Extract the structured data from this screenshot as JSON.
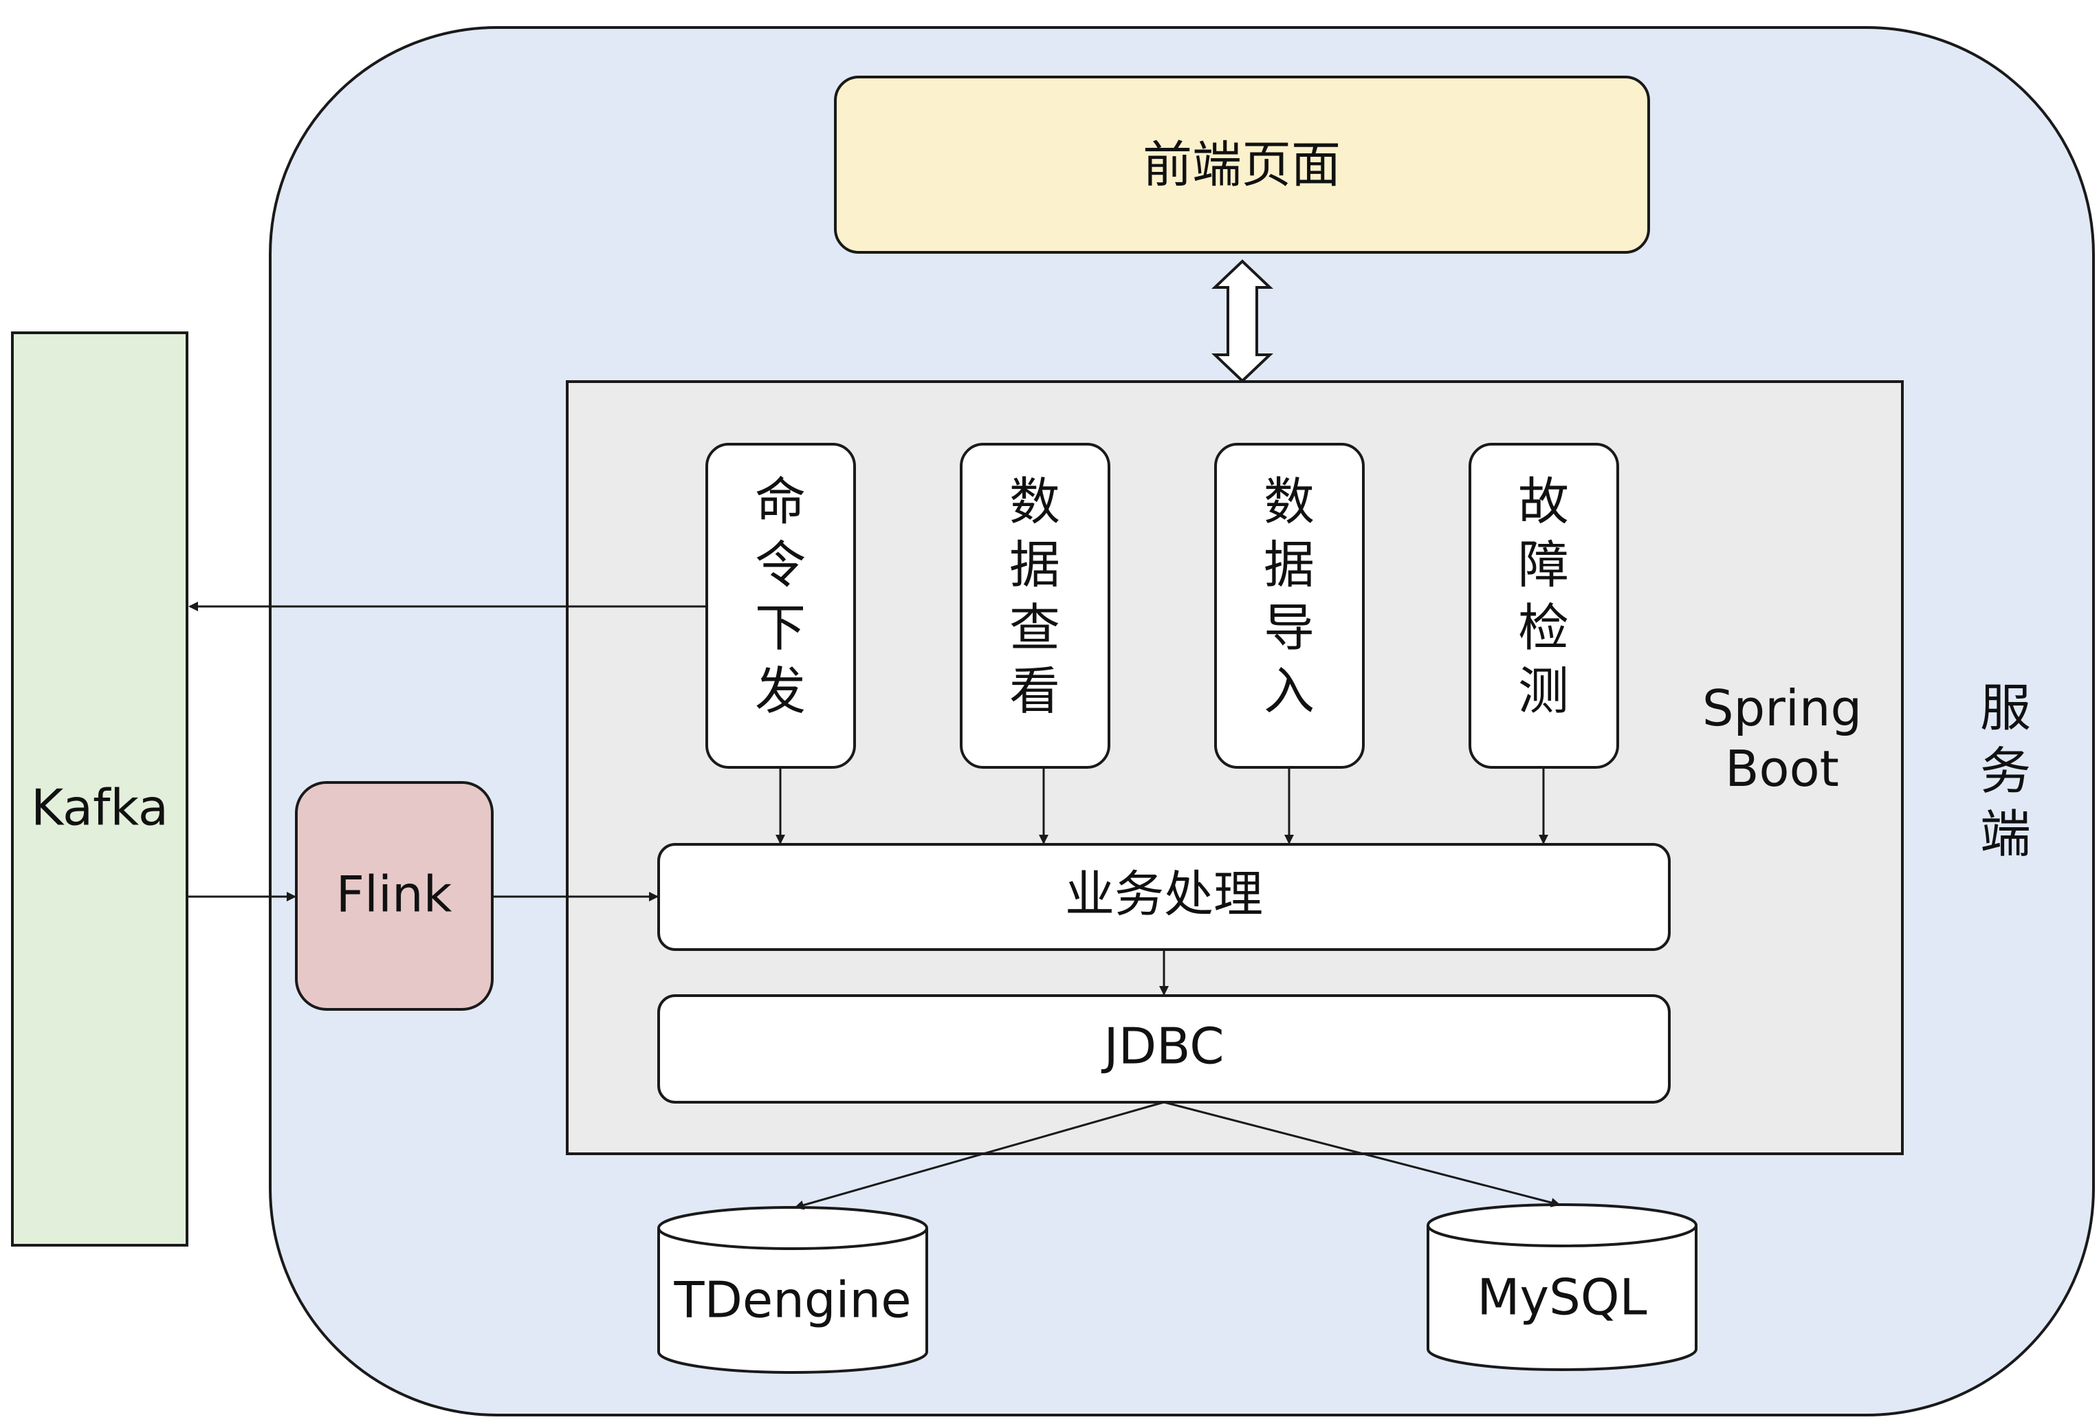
{
  "diagram": {
    "server_container": {
      "label": "服\n务\n端"
    },
    "kafka": {
      "label": "Kafka"
    },
    "flink": {
      "label": "Flink"
    },
    "frontend": {
      "label": "前端页面"
    },
    "spring_boot": {
      "label": "Spring\nBoot"
    },
    "modules": [
      {
        "label": "命\n令\n下\n发"
      },
      {
        "label": "数\n据\n查\n看"
      },
      {
        "label": "数\n据\n导\n入"
      },
      {
        "label": "故\n障\n检\n测"
      }
    ],
    "business": {
      "label": "业务处理"
    },
    "jdbc": {
      "label": "JDBC"
    },
    "databases": [
      {
        "label": "TDengine"
      },
      {
        "label": "MySQL"
      }
    ]
  },
  "colors": {
    "server_fill": "#e1e9f6",
    "kafka_fill": "#e2efda",
    "flink_fill": "#e6c8c8",
    "frontend_fill": "#fbf1cc",
    "spring_fill": "#ebebeb",
    "box_fill": "#ffffff",
    "stroke": "#1a1a1a"
  }
}
